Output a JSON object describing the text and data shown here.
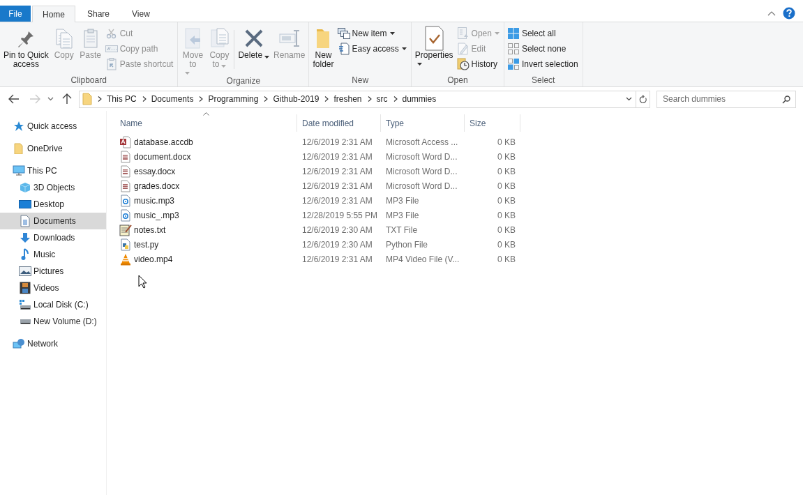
{
  "tabs": [
    {
      "label": "File",
      "kind": "file",
      "selected": false
    },
    {
      "label": "Home",
      "kind": "tab",
      "selected": true
    },
    {
      "label": "Share",
      "kind": "tab",
      "selected": false
    },
    {
      "label": "View",
      "kind": "tab",
      "selected": false
    }
  ],
  "ribbon": {
    "groups": [
      {
        "label": "Clipboard",
        "commands": [
          {
            "label": "Pin to Quick\naccess",
            "kind": "large",
            "disabled": false,
            "dropdown": false
          },
          {
            "label": "Copy",
            "kind": "large",
            "disabled": true,
            "dropdown": false
          },
          {
            "label": "Paste",
            "kind": "large",
            "disabled": true,
            "dropdown": false
          },
          {
            "label": "Cut",
            "kind": "small",
            "disabled": true,
            "dropdown": false
          },
          {
            "label": "Copy path",
            "kind": "small",
            "disabled": true,
            "dropdown": false
          },
          {
            "label": "Paste shortcut",
            "kind": "small",
            "disabled": true,
            "dropdown": false
          }
        ]
      },
      {
        "label": "Organize",
        "commands": [
          {
            "label": "Move\nto",
            "kind": "large",
            "disabled": true,
            "dropdown": true
          },
          {
            "label": "Copy\nto",
            "kind": "large",
            "disabled": true,
            "dropdown": true
          },
          {
            "label": "Delete",
            "kind": "large",
            "disabled": false,
            "dropdown": true
          },
          {
            "label": "Rename",
            "kind": "large",
            "disabled": true,
            "dropdown": false
          }
        ]
      },
      {
        "label": "New",
        "commands": [
          {
            "label": "New\nfolder",
            "kind": "large",
            "disabled": false,
            "dropdown": false
          },
          {
            "label": "New item",
            "kind": "small",
            "disabled": false,
            "dropdown": true
          },
          {
            "label": "Easy access",
            "kind": "small",
            "disabled": false,
            "dropdown": true
          }
        ]
      },
      {
        "label": "Open",
        "commands": [
          {
            "label": "Properties",
            "kind": "large",
            "disabled": false,
            "dropdown": true
          },
          {
            "label": "Open",
            "kind": "small",
            "disabled": true,
            "dropdown": true
          },
          {
            "label": "Edit",
            "kind": "small",
            "disabled": true,
            "dropdown": false
          },
          {
            "label": "History",
            "kind": "small",
            "disabled": false,
            "dropdown": false
          }
        ]
      },
      {
        "label": "Select",
        "commands": [
          {
            "label": "Select all",
            "kind": "small",
            "disabled": false,
            "dropdown": false
          },
          {
            "label": "Select none",
            "kind": "small",
            "disabled": false,
            "dropdown": false
          },
          {
            "label": "Invert selection",
            "kind": "small",
            "disabled": false,
            "dropdown": false
          }
        ]
      }
    ]
  },
  "navigation": {
    "back_disabled": false,
    "forward_disabled": true
  },
  "address_bar": {
    "path": [
      "This PC",
      "Documents",
      "Programming",
      "Github-2019",
      "freshen",
      "src",
      "dummies"
    ]
  },
  "search": {
    "placeholder": "Search dummies"
  },
  "sidebar": {
    "items": [
      {
        "label": "Quick access",
        "kind": "quick",
        "selected": false
      },
      {
        "label": "OneDrive",
        "kind": "folder",
        "selected": false
      },
      {
        "label": "This PC",
        "kind": "pc",
        "selected": false,
        "children": [
          {
            "label": "3D Objects",
            "kind": "cube",
            "selected": false
          },
          {
            "label": "Desktop",
            "kind": "desktop",
            "selected": false
          },
          {
            "label": "Documents",
            "kind": "documents",
            "selected": true
          },
          {
            "label": "Downloads",
            "kind": "downloads",
            "selected": false
          },
          {
            "label": "Music",
            "kind": "music",
            "selected": false
          },
          {
            "label": "Pictures",
            "kind": "pictures",
            "selected": false
          },
          {
            "label": "Videos",
            "kind": "videos",
            "selected": false
          },
          {
            "label": "Local Disk (C:)",
            "kind": "sysdisk",
            "selected": false
          },
          {
            "label": "New Volume (D:)",
            "kind": "disk",
            "selected": false
          }
        ]
      },
      {
        "label": "Network",
        "kind": "network",
        "selected": false
      }
    ]
  },
  "table": {
    "columns": [
      {
        "label": "Name",
        "sorted": true
      },
      {
        "label": "Date modified",
        "sorted": false
      },
      {
        "label": "Type",
        "sorted": false
      },
      {
        "label": "Size",
        "sorted": false
      }
    ],
    "rows": [
      {
        "name": "database.accdb",
        "kind": "access",
        "date": "12/6/2019 2:31 AM",
        "type": "Microsoft Access ...",
        "size": "0 KB"
      },
      {
        "name": "document.docx",
        "kind": "word",
        "date": "12/6/2019 2:31 AM",
        "type": "Microsoft Word D...",
        "size": "0 KB"
      },
      {
        "name": "essay.docx",
        "kind": "word",
        "date": "12/6/2019 2:31 AM",
        "type": "Microsoft Word D...",
        "size": "0 KB"
      },
      {
        "name": "grades.docx",
        "kind": "word",
        "date": "12/6/2019 2:31 AM",
        "type": "Microsoft Word D...",
        "size": "0 KB"
      },
      {
        "name": "music.mp3",
        "kind": "audio",
        "date": "12/6/2019 2:31 AM",
        "type": "MP3 File",
        "size": "0 KB"
      },
      {
        "name": "music_.mp3",
        "kind": "audio",
        "date": "12/28/2019 5:55 PM",
        "type": "MP3 File",
        "size": "0 KB"
      },
      {
        "name": "notes.txt",
        "kind": "text",
        "date": "12/6/2019 2:30 AM",
        "type": "TXT File",
        "size": "0 KB"
      },
      {
        "name": "test.py",
        "kind": "python",
        "date": "12/6/2019 2:30 AM",
        "type": "Python File",
        "size": "0 KB"
      },
      {
        "name": "video.mp4",
        "kind": "video",
        "date": "12/6/2019 2:31 AM",
        "type": "MP4 Video File (V...",
        "size": "0 KB"
      }
    ]
  }
}
